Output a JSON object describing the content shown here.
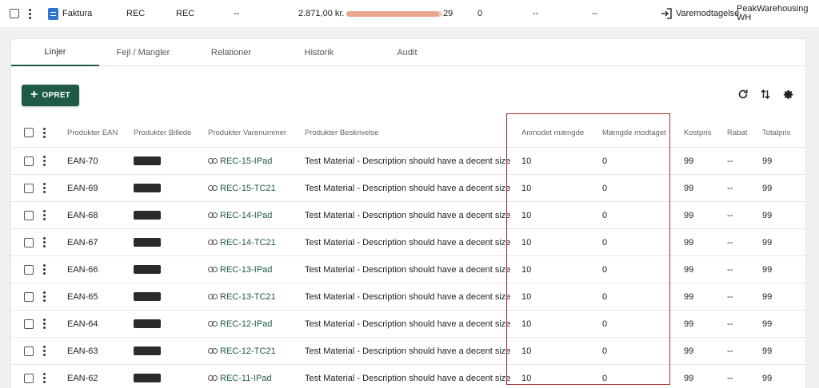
{
  "top_row": {
    "doc_label": "Faktura",
    "col_type": "REC",
    "col_status": "REC",
    "col_dash1": "--",
    "amount": "2.871,00 kr.",
    "progress_fraction": 0.97,
    "count": "29",
    "zero": "0",
    "col_dash2": "--",
    "col_dash3": "--",
    "action_label": "Varemodtagelse",
    "warehouse": "PeakWarehousing WH"
  },
  "tabs": [
    {
      "label": "Linjer",
      "active": true
    },
    {
      "label": "Fejl / Mangler",
      "active": false
    },
    {
      "label": "Relationer",
      "active": false
    },
    {
      "label": "Historik",
      "active": false
    },
    {
      "label": "Audit",
      "active": false
    }
  ],
  "toolbar": {
    "create_label": "OPRET",
    "refresh_icon": "refresh-icon",
    "sort_icon": "sort-icon",
    "settings_icon": "gear-icon"
  },
  "table": {
    "headers": {
      "ean": "Produkter EAN",
      "image": "Produkter Billede",
      "itemno": "Produkter Varenummer",
      "desc": "Produkter Beskrivelse",
      "requested": "Anmodet mængde",
      "received": "Mængde modtaget",
      "cost": "Kostpris",
      "discount": "Rabat",
      "total": "Totalpris"
    },
    "rows": [
      {
        "ean": "EAN-70",
        "itemno": "REC-15-IPad",
        "desc": "Test Material - Description should have a decent size",
        "requested": "10",
        "received": "0",
        "cost": "99",
        "discount": "--",
        "total": "99"
      },
      {
        "ean": "EAN-69",
        "itemno": "REC-15-TC21",
        "desc": "Test Material - Description should have a decent size",
        "requested": "10",
        "received": "0",
        "cost": "99",
        "discount": "--",
        "total": "99"
      },
      {
        "ean": "EAN-68",
        "itemno": "REC-14-IPad",
        "desc": "Test Material - Description should have a decent size",
        "requested": "10",
        "received": "0",
        "cost": "99",
        "discount": "--",
        "total": "99"
      },
      {
        "ean": "EAN-67",
        "itemno": "REC-14-TC21",
        "desc": "Test Material - Description should have a decent size",
        "requested": "10",
        "received": "0",
        "cost": "99",
        "discount": "--",
        "total": "99"
      },
      {
        "ean": "EAN-66",
        "itemno": "REC-13-IPad",
        "desc": "Test Material - Description should have a decent size",
        "requested": "10",
        "received": "0",
        "cost": "99",
        "discount": "--",
        "total": "99"
      },
      {
        "ean": "EAN-65",
        "itemno": "REC-13-TC21",
        "desc": "Test Material - Description should have a decent size",
        "requested": "10",
        "received": "0",
        "cost": "99",
        "discount": "--",
        "total": "99"
      },
      {
        "ean": "EAN-64",
        "itemno": "REC-12-IPad",
        "desc": "Test Material - Description should have a decent size",
        "requested": "10",
        "received": "0",
        "cost": "99",
        "discount": "--",
        "total": "99"
      },
      {
        "ean": "EAN-63",
        "itemno": "REC-12-TC21",
        "desc": "Test Material - Description should have a decent size",
        "requested": "10",
        "received": "0",
        "cost": "99",
        "discount": "--",
        "total": "99"
      },
      {
        "ean": "EAN-62",
        "itemno": "REC-11-IPad",
        "desc": "Test Material - Description should have a decent size",
        "requested": "10",
        "received": "0",
        "cost": "99",
        "discount": "--",
        "total": "99"
      }
    ]
  },
  "colors": {
    "primary": "#1f5a47",
    "highlight_border": "#a72b2b",
    "progress_track": "#f6c9b8",
    "doc_icon": "#2f74d0"
  }
}
